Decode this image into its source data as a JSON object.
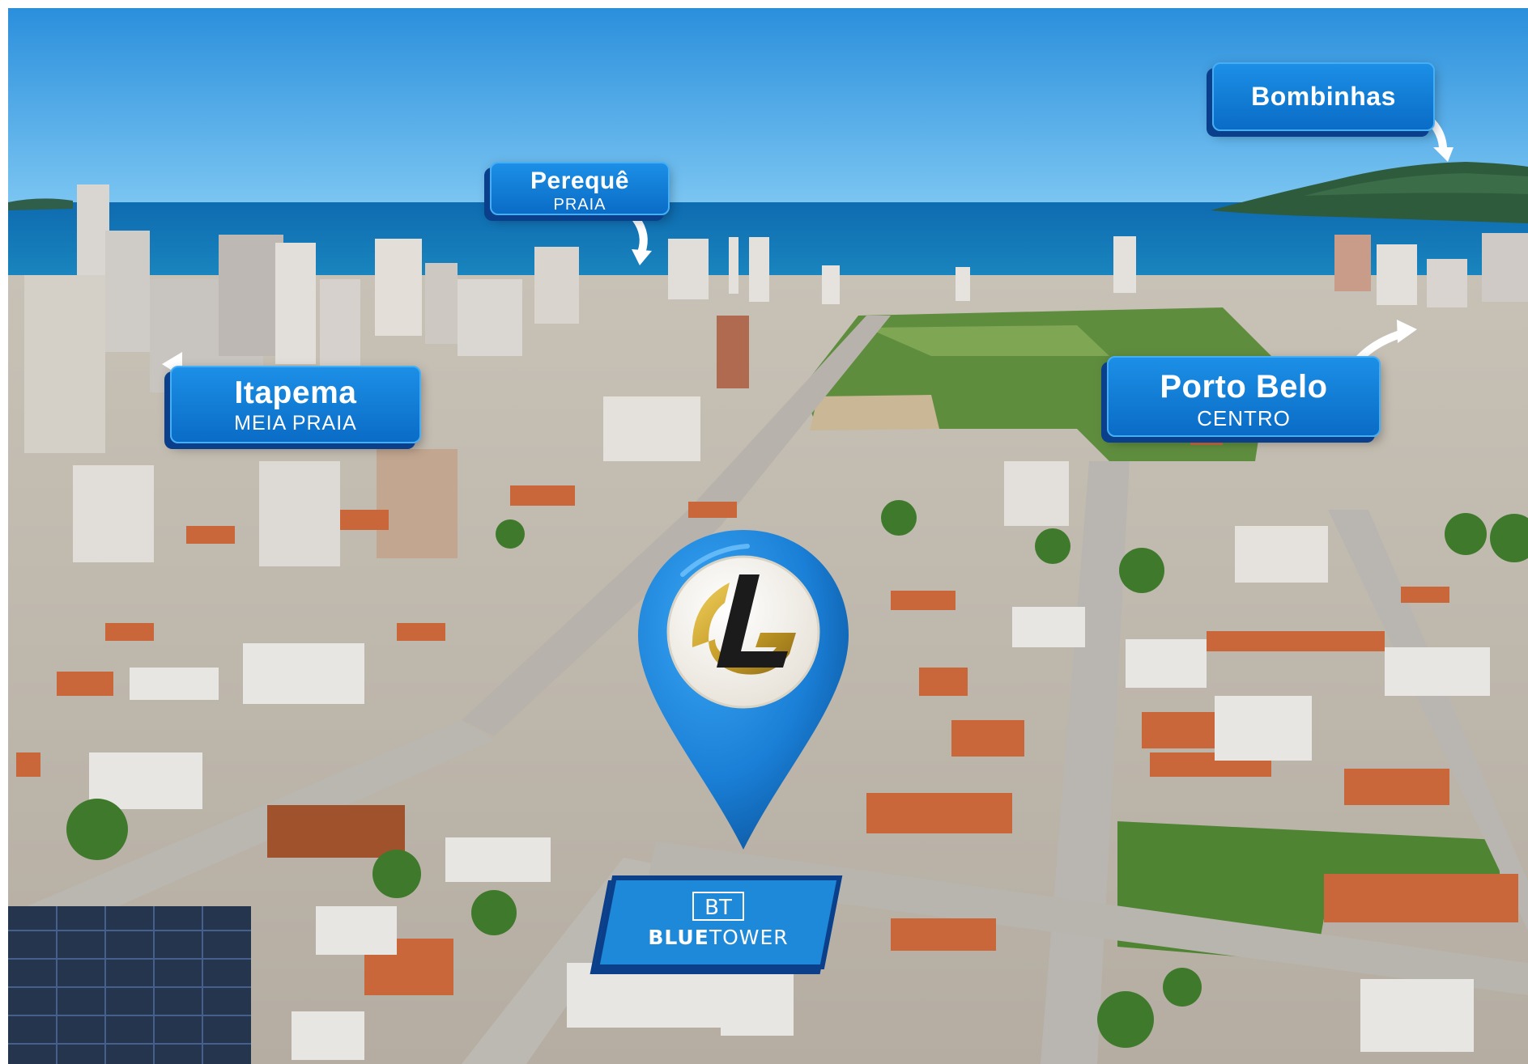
{
  "image": {
    "description_none": true,
    "colors": {
      "sky": "#3fa6e6",
      "ocean": "#1579b8",
      "label_blue": "#1a86df",
      "label_shadow": "#0a3f8c",
      "pin_blue": "#1a7fd6",
      "logo_gold": "#c9a02a"
    }
  },
  "labels": {
    "pereque": {
      "main": "Perequê",
      "sub": "PRAIA"
    },
    "bombinhas": {
      "main": "Bombinhas"
    },
    "itapema": {
      "main": "Itapema",
      "sub": "MEIA PRAIA"
    },
    "porto_belo": {
      "main": "Porto Belo",
      "sub": "CENTRO"
    }
  },
  "brand": {
    "monogram": "BT",
    "word_bold": "BLUE",
    "word_light": "TOWER"
  },
  "icons": {
    "pin": "location-pin-icon",
    "logo": "lg-gold-logo-icon",
    "arrow": "curved-arrow-icon"
  }
}
